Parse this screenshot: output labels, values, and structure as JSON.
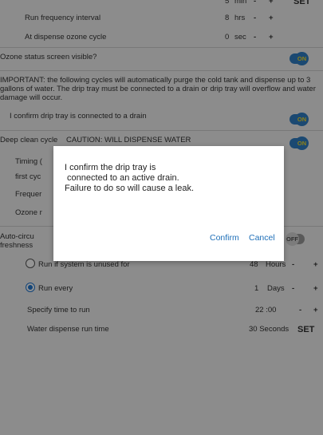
{
  "settings": {
    "top_partial": {
      "value": "5",
      "unit": "min",
      "minus": "-",
      "plus": "+",
      "set_label": "SET"
    },
    "run_frequency": {
      "label": "Run frequency interval",
      "value": "8",
      "unit": "hrs",
      "minus": "-",
      "plus": "+"
    },
    "at_dispense": {
      "label": "At dispense ozone cycle",
      "value": "0",
      "unit": "sec",
      "minus": "-",
      "plus": "+"
    },
    "ozone_status": {
      "label": "Ozone status screen visible?",
      "toggle": "ON"
    },
    "important_text": "IMPORTANT: the following cycles will automatically purge the cold tank and dispense up to 3 gallons of water. The drip tray must be connected to a drain or drip tray will overflow and water damage will occur.",
    "drip_tray_confirm": {
      "label": "I confirm drip tray is connected to a drain",
      "toggle": "ON"
    },
    "deep_clean": {
      "label": "Deep clean cycle",
      "caution": "CAUTION: WILL DISPENSE WATER",
      "toggle": "ON"
    },
    "deep_rows_partial": [
      "Timing (",
      "first cyc",
      "Frequer",
      "Ozone r"
    ],
    "auto_circ": {
      "label_line1": "Auto-circu",
      "label_line2": "freshness",
      "toggle": "OFF"
    },
    "run_if_unused": {
      "label": "Run if system is unused for",
      "value": "48",
      "unit": "Hours",
      "minus": "-",
      "plus": "+"
    },
    "run_every": {
      "label": "Run every",
      "value": "1",
      "unit": "Days",
      "minus": "-",
      "plus": "+"
    },
    "specify_time": {
      "label": "Specify time to run",
      "value": "22 :00",
      "minus": "-",
      "plus": "+"
    },
    "water_dispense": {
      "label": "Water dispense run time",
      "value": "30 Seconds",
      "set_label": "SET"
    }
  },
  "dialog": {
    "message_lines": [
      "I confirm the drip tray is",
      " connected to an active drain.",
      "Failure to do so will cause a leak."
    ],
    "confirm_label": "Confirm",
    "cancel_label": "Cancel"
  },
  "colors": {
    "accent": "#2f7fc4",
    "toggle_text": "#f5dc2b",
    "dialog_button": "#1e6fb8"
  }
}
